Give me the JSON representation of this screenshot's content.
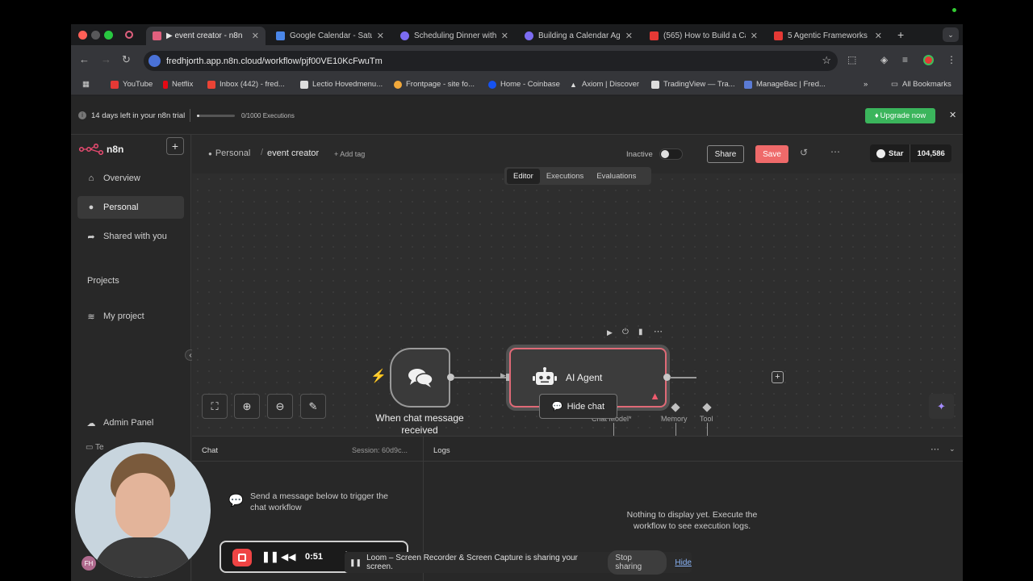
{
  "browser": {
    "tabs": [
      {
        "title": "▶ event creator - n8n",
        "color": "#e0607e"
      },
      {
        "title": "Google Calendar - Saturday",
        "color": "#4a86e8"
      },
      {
        "title": "Scheduling Dinner with",
        "color": "#7c6cf2"
      },
      {
        "title": "Building a Calendar Agent",
        "color": "#7c6cf2"
      },
      {
        "title": "(565) How to Build a Ca",
        "color": "#e53935"
      },
      {
        "title": "5 Agentic Frameworks",
        "color": "#e53935"
      }
    ],
    "url": "fredhjorth.app.n8n.cloud/workflow/pjf00VE10KcFwuTm",
    "bookmarks": [
      {
        "label": "YouTube",
        "color": "#e53935"
      },
      {
        "label": "Netflix",
        "color": "#e50914"
      },
      {
        "label": "Inbox (442) - fred...",
        "color": "#ea4335"
      },
      {
        "label": "Lectio Hovedmenu...",
        "color": "#dddddd"
      },
      {
        "label": "Frontpage - site fo...",
        "color": "#f2a93b"
      },
      {
        "label": "Home - Coinbase",
        "color": "#1652f0"
      },
      {
        "label": "Axiom | Discover",
        "color": "#dddddd"
      },
      {
        "label": "TradingView — Tra...",
        "color": "#dddddd"
      },
      {
        "label": "ManageBac | Fred...",
        "color": "#5b7bd5"
      }
    ],
    "all_bookmarks": "All Bookmarks"
  },
  "trial": {
    "text": "14 days left in your n8n trial",
    "executions": "0/1000 Executions",
    "executions_fraction": 0.0,
    "upgrade": "Upgrade now"
  },
  "sidebar": {
    "brand": "n8n",
    "items": [
      {
        "label": "Overview",
        "icon": "home-icon"
      },
      {
        "label": "Personal",
        "icon": "user-icon"
      },
      {
        "label": "Shared with you",
        "icon": "share-icon"
      }
    ],
    "projects_heading": "Projects",
    "project": "My project",
    "admin": "Admin Panel",
    "collapse": "‹"
  },
  "header": {
    "breadcrumb_owner": "Personal",
    "workflow_name": "event creator",
    "add_tag": "+ Add tag",
    "active_label": "Inactive",
    "share": "Share",
    "save": "Save",
    "star": "Star",
    "star_count": "104,586",
    "tabs": [
      "Editor",
      "Executions",
      "Evaluations"
    ]
  },
  "canvas": {
    "trigger_label": "When chat message received",
    "agent_label": "AI Agent",
    "sub_labels": [
      "Chat Model*",
      "Memory",
      "Tool"
    ],
    "hide_chat": "Hide chat"
  },
  "chat_panel": {
    "title": "Chat",
    "session": "Session: 60d9c...",
    "empty": "Send a message below to trigger the chat workflow"
  },
  "logs_panel": {
    "title": "Logs",
    "empty": "Nothing to display yet. Execute the workflow to see execution logs."
  },
  "overlays": {
    "record_time": "0:51",
    "sharing_text": "Loom – Screen Recorder & Screen Capture is sharing your screen.",
    "stop_sharing": "Stop sharing",
    "hide": "Hide",
    "avatar_initials": "FH"
  },
  "colors": {
    "save_btn": "#ef6a6a",
    "upgrade_btn": "#3bb55c",
    "agent_border": "#e06a77",
    "record_red": "#ef4444"
  }
}
